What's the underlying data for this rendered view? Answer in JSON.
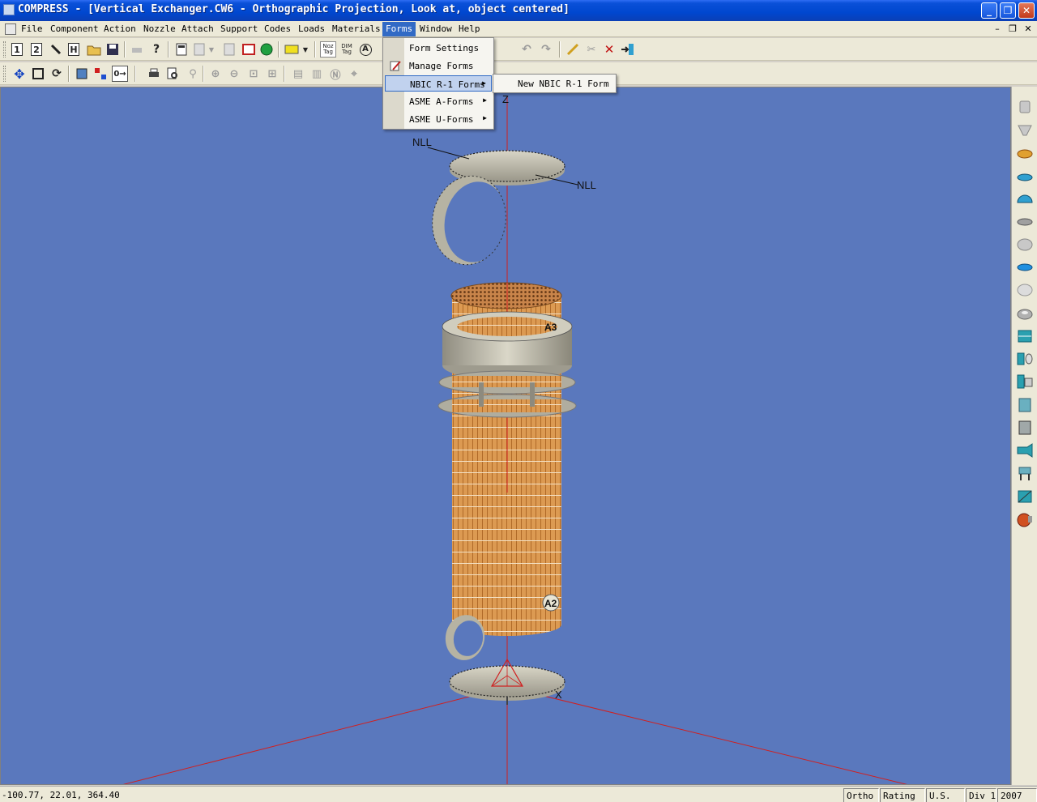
{
  "window": {
    "title": "COMPRESS - [Vertical Exchanger.CW6 - Orthographic Projection, Look at, object centered]",
    "minimize_glyph": "_",
    "maximize_glyph": "❐",
    "close_glyph": "✕"
  },
  "menubar": {
    "items": [
      {
        "label": "File"
      },
      {
        "label": "Component"
      },
      {
        "label": "Action"
      },
      {
        "label": "Nozzle"
      },
      {
        "label": "Attach"
      },
      {
        "label": "Support"
      },
      {
        "label": "Codes"
      },
      {
        "label": "Loads"
      },
      {
        "label": "Materials"
      },
      {
        "label": "Forms",
        "active": true
      },
      {
        "label": "Window"
      },
      {
        "label": "Help"
      }
    ],
    "mdi_minimize": "–",
    "mdi_restore": "❐",
    "mdi_close": "✕"
  },
  "toolbar": {
    "btn1": "1",
    "btn2": "2",
    "btn_h": "H",
    "noz_tag": "Noz Tag",
    "dim_tag": "DIM Tag",
    "btn_a": "A"
  },
  "forms_menu": {
    "items": [
      {
        "label": "Form Settings",
        "has_submenu": false
      },
      {
        "label": "Manage Forms",
        "has_submenu": false
      },
      {
        "label": "NBIC R-1 Forms",
        "has_submenu": true,
        "highlighted": true
      },
      {
        "label": "ASME A-Forms",
        "has_submenu": true
      },
      {
        "label": "ASME U-Forms",
        "has_submenu": true
      }
    ],
    "arrow_glyph": "▶"
  },
  "nbic_submenu": {
    "items": [
      {
        "label": "New NBIC R-1 Form"
      }
    ]
  },
  "viewport": {
    "axis_label": "Z",
    "nll_label_left": "NLL",
    "nll_label_right": "NLL",
    "nozzle_a3": "A3",
    "nozzle_a2": "A2",
    "axis_x_marker": "X",
    "background_color": "#5a78bd",
    "tube_color": "#d9974f",
    "metal_color": "#c8c4b4",
    "axis_color": "#d02020"
  },
  "statusbar": {
    "coordinates": "-100.77, 22.01, 364.40",
    "projection": "Ortho",
    "mode": "Rating",
    "units": "U.S.",
    "division": "Div 1",
    "year": "2007"
  },
  "palette": {
    "icons": [
      "cone-icon",
      "conical-head-icon",
      "ellipsoidal-head-icon",
      "torispherical-head-icon",
      "hemispherical-head-icon",
      "flat-head-icon",
      "flanged-head-icon",
      "blind-flange-icon",
      "bolted-cover-icon",
      "flange-icon",
      "shell-band-icon",
      "nozzle-icon",
      "tubesheet-icon",
      "cylinder-icon",
      "heat-exchanger-icon",
      "transition-icon",
      "leg-support-icon",
      "saddle-icon",
      "lifting-lug-icon"
    ]
  }
}
